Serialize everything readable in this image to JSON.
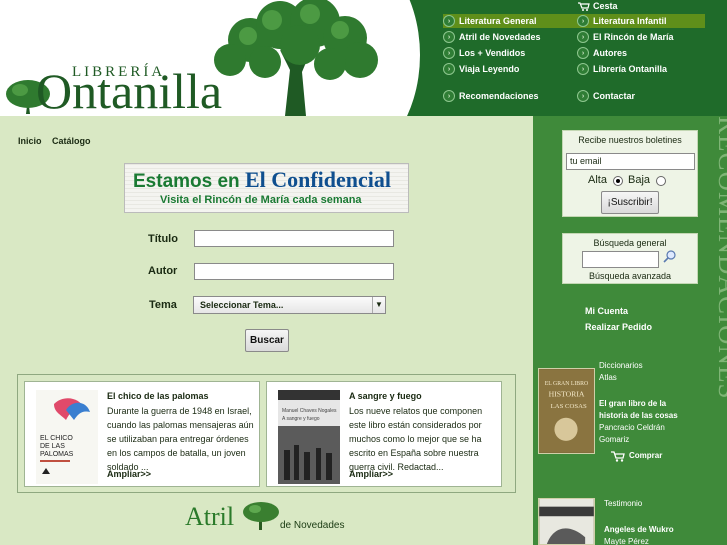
{
  "header": {
    "logo_small": "LIBRERÍA",
    "logo_big": "Ontanilla",
    "cart_label": "Cesta",
    "menu": [
      {
        "label": "Literatura General",
        "active": true
      },
      {
        "label": "Literatura Infantil",
        "active": true
      },
      {
        "label": "Atril de Novedades",
        "active": false
      },
      {
        "label": "El Rincón de María",
        "active": false
      },
      {
        "label": "Los + Vendidos",
        "active": false
      },
      {
        "label": "Autores",
        "active": false
      },
      {
        "label": "Viaja Leyendo",
        "active": false
      },
      {
        "label": "Librería Ontanilla",
        "active": false
      },
      {
        "label": "Recomendaciones",
        "active": false
      },
      {
        "label": "Contactar",
        "active": false
      }
    ]
  },
  "breadcrumb": [
    "Inicio",
    "Catálogo"
  ],
  "banner": {
    "line1_prefix": "Estamos en",
    "line1_brand": "El Confidencial",
    "line2": "Visita el Rincón de María cada semana"
  },
  "search_form": {
    "title_label": "Título",
    "author_label": "Autor",
    "theme_label": "Tema",
    "theme_selected": "Seleccionar Tema...",
    "submit_label": "Buscar"
  },
  "books": [
    {
      "title": "El chico de las palomas",
      "text": "Durante la guerra de 1948 en Israel, cuando las palomas mensajeras aún se utilizaban para entregar órdenes en los campos de batalla, un joven soldado ...",
      "more": "Ampliar>>"
    },
    {
      "title": "A sangre y fuego",
      "text": "Los nueve relatos que componen este libro están considerados por muchos como lo mejor que se ha escrito en España sobre nuestra guerra civil. Redactad...",
      "more": "Ampliar>>"
    }
  ],
  "atril": {
    "word": "Atril",
    "sub": "de Novedades"
  },
  "sidebar": {
    "vertical_text": "RECOMENDACIONES",
    "newsletter": {
      "title": "Recibe nuestros boletines",
      "email_value": "tu email",
      "alta_label": "Alta",
      "baja_label": "Baja",
      "submit_label": "¡Suscribir!"
    },
    "search": {
      "title": "Búsqueda general",
      "advanced_label": "Búsqueda avanzada"
    },
    "account_label": "Mi Cuenta",
    "order_label": "Realizar Pedido",
    "featured": {
      "category1": "Diccionarios",
      "category2": "Atlas",
      "title_line1": "El gran libro de la",
      "title_line2": "historia de las cosas",
      "author_line1": "Pancracio Celdrán",
      "author_line2": "Gomariz",
      "buy_label": "Comprar"
    },
    "featured2": {
      "category": "Testimonio",
      "title": "Angeles de Wukro",
      "author": "Mayte Pérez"
    }
  },
  "colors": {
    "header_green": "#1f6b2a",
    "page_bg": "#d9e8c4",
    "sidebar_green": "#3f8a3a",
    "active_menu": "#5f8f1a"
  }
}
